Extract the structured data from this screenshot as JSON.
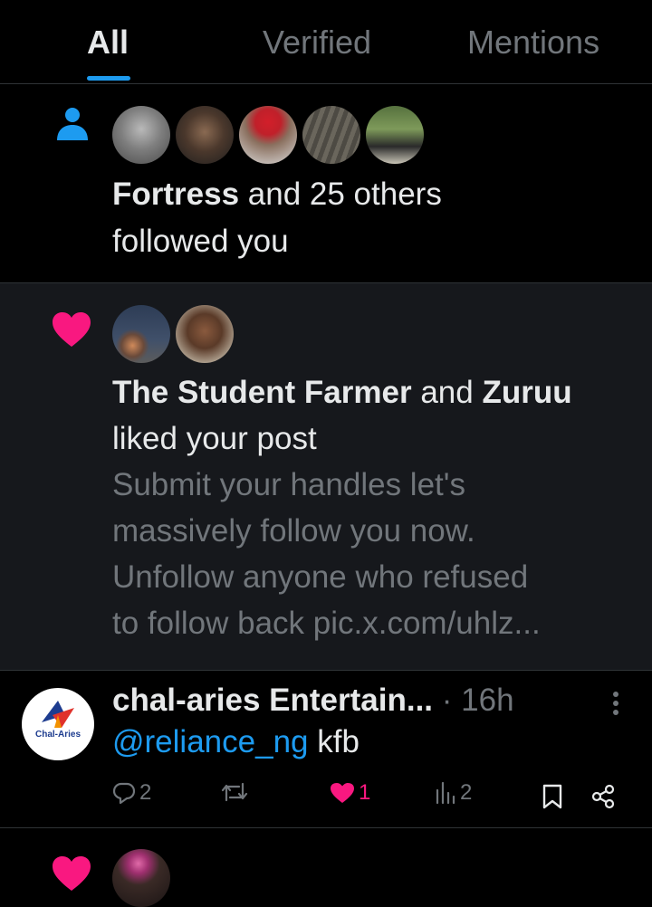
{
  "tabs": [
    {
      "label": "All",
      "active": true
    },
    {
      "label": "Verified",
      "active": false
    },
    {
      "label": "Mentions",
      "active": false
    }
  ],
  "follow_notification": {
    "icon": "person-icon",
    "name": "Fortress",
    "rest_line1": " and 25 others",
    "line2": "followed you"
  },
  "like_notification": {
    "icon": "heart-icon",
    "name1": "The Student Farmer",
    "and": " and ",
    "name2": "Zuruu",
    "line2": "liked your post",
    "preview": [
      "Submit your handles let's",
      "massively follow you now.",
      "Unfollow anyone who refused",
      "to follow back pic.x.com/uhlz..."
    ]
  },
  "post": {
    "avatar_text": "Chal-Aries",
    "author": "chal-aries Entertain...",
    "sep": " · ",
    "time": "16h",
    "mention": "@reliance_ng",
    "text": " kfb",
    "replies": "2",
    "reposts": "",
    "likes": "1",
    "views": "2"
  },
  "colors": {
    "accent": "#1d9bf0",
    "like_pink": "#f91880",
    "muted": "#71767b",
    "unread_bg": "#16181c"
  }
}
